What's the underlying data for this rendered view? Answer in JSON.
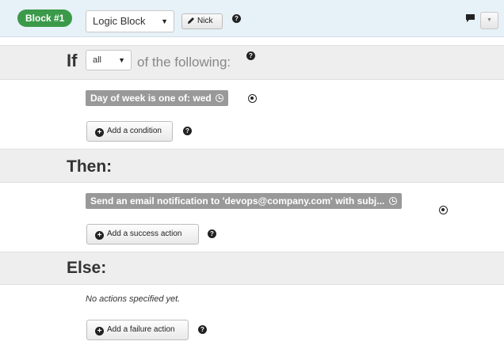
{
  "header": {
    "block_badge": "Block #1",
    "block_type": "Logic Block",
    "nick_label": "Nick",
    "help_glyph": "?",
    "dropdown_glyph": "▼"
  },
  "if_section": {
    "keyword": "If",
    "match_select_value": "all",
    "suffix": "of the following:"
  },
  "conditions": [
    {
      "text": "Day of week is one of: wed"
    }
  ],
  "add_condition_label": "Add a condition",
  "then_section": {
    "title": "Then:",
    "actions": [
      {
        "text": "Send an email notification to 'devops@company.com' with subj..."
      }
    ],
    "add_label": "Add a success action"
  },
  "else_section": {
    "title": "Else:",
    "empty_text": "No actions specified yet.",
    "add_label": "Add a failure action"
  },
  "colors": {
    "badge_green": "#3b9a4a",
    "header_bg": "#e7f1f8",
    "section_bg": "#eeeeee",
    "pill_gray": "#999999"
  },
  "icons": [
    "pencil-icon",
    "help-icon",
    "comment-icon",
    "clock-icon",
    "remove-icon",
    "plus-circle-icon",
    "caret-down-icon"
  ]
}
